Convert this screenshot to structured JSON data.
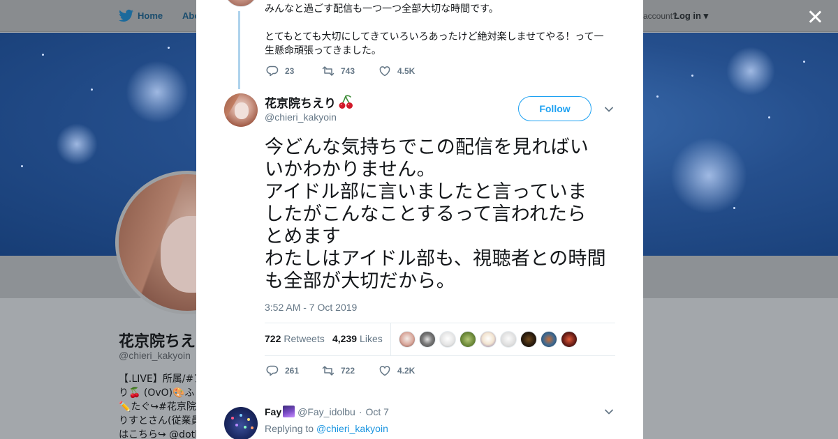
{
  "topnav": {
    "home_label": "Home",
    "about_label": "Abo",
    "account_text": "account?",
    "login_label": "Log in"
  },
  "profile": {
    "name": "花京院ちえ",
    "handle": "@chieri_kakyoin",
    "bio_lines": [
      "【.LIVE】所属/#ア",
      "り🍒 (OvO)🎨ふ",
      "✏️たぐ↪#花京院",
      "りすとさん(従業員",
      "はこちら↪ @dotl"
    ]
  },
  "previous_tweet": {
    "line1": "みんなと過ごす配信も一つ一つ全部大切な時間です。",
    "line2a": "とてもとても大切にしてきていろいろあったけど絶対楽しませてやる！って一",
    "line2b": "生懸命頑張ってきました。",
    "replies": "23",
    "retweets": "743",
    "likes": "4.5K"
  },
  "tweet": {
    "author_name": "花京院ちえり",
    "author_handle": "@chieri_kakyoin",
    "follow_label": "Follow",
    "text_lines": [
      "今どんな気持ちでこの配信を見ればい",
      "いかわかりません。",
      "アイドル部に言いましたと言っていま",
      "したがこんなことするって言われたら",
      "とめます",
      "わたしはアイドル部も、視聴者との時間",
      "も全部が大切だから。"
    ],
    "timestamp": "3:52 AM - 7 Oct 2019",
    "retweet_count": "722",
    "retweet_label": "Retweets",
    "like_count": "4,239",
    "like_label": "Likes",
    "replies": "261",
    "retweets": "722",
    "likes": "4.2K"
  },
  "reply": {
    "name": "Fay",
    "handle": "@Fay_idolbu",
    "sep": "·",
    "date": "Oct 7",
    "replying_prefix": "Replying to",
    "replying_to": "@chieri_kakyoin"
  },
  "colors": {
    "accent": "#1da1f2",
    "text": "#14171a",
    "muted": "#657786",
    "thread_line": "#aed3ec"
  },
  "icons": [
    "twitter-bird-icon",
    "close-icon",
    "reply-icon",
    "retweet-icon",
    "like-icon",
    "chevron-down-icon",
    "cherry-emoji-icon",
    "galaxy-emoji-icon"
  ]
}
